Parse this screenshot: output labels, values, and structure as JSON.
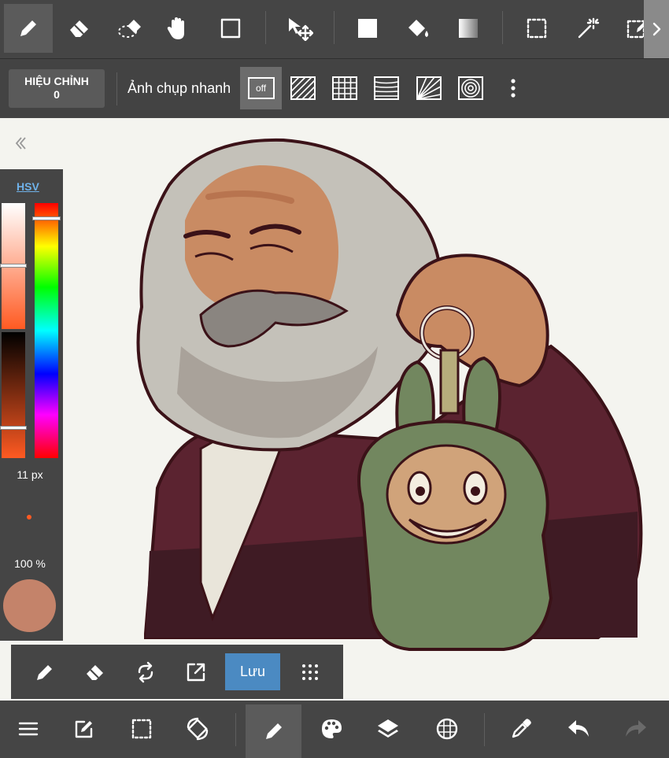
{
  "top_toolbar": {
    "tools": [
      {
        "name": "pen-icon",
        "active": true
      },
      {
        "name": "eraser-icon"
      },
      {
        "name": "blur-eraser-icon"
      },
      {
        "name": "hand-icon"
      },
      {
        "name": "rectangle-icon"
      },
      {
        "name": "move-icon"
      },
      {
        "name": "fill-square-icon"
      },
      {
        "name": "bucket-icon"
      },
      {
        "name": "gradient-icon"
      },
      {
        "name": "select-rect-icon"
      },
      {
        "name": "magic-wand-icon"
      },
      {
        "name": "select-pen-icon"
      }
    ]
  },
  "sub_toolbar": {
    "correction_label": "HIỆU CHỈNH",
    "correction_value": "0",
    "snapshot_label": "Ảnh chụp nhanh",
    "snap_off_label": "off"
  },
  "color_panel": {
    "mode_label": "HSV",
    "brush_size": "11 px",
    "opacity": "100 %",
    "current_color": "#c4836a"
  },
  "float_toolbar": {
    "save_label": "Lưu"
  },
  "bottom_bar": {
    "items": [
      "menu-icon",
      "edit-icon",
      "selection-icon",
      "rotate-icon",
      "brush-icon",
      "palette-icon",
      "layers-icon",
      "grid-icon",
      "eyedropper-icon",
      "undo-icon",
      "redo-icon"
    ]
  },
  "colors": {
    "toolbar_bg": "#454545",
    "accent": "#4b8ac2",
    "hsv_link": "#6fb2ea"
  }
}
